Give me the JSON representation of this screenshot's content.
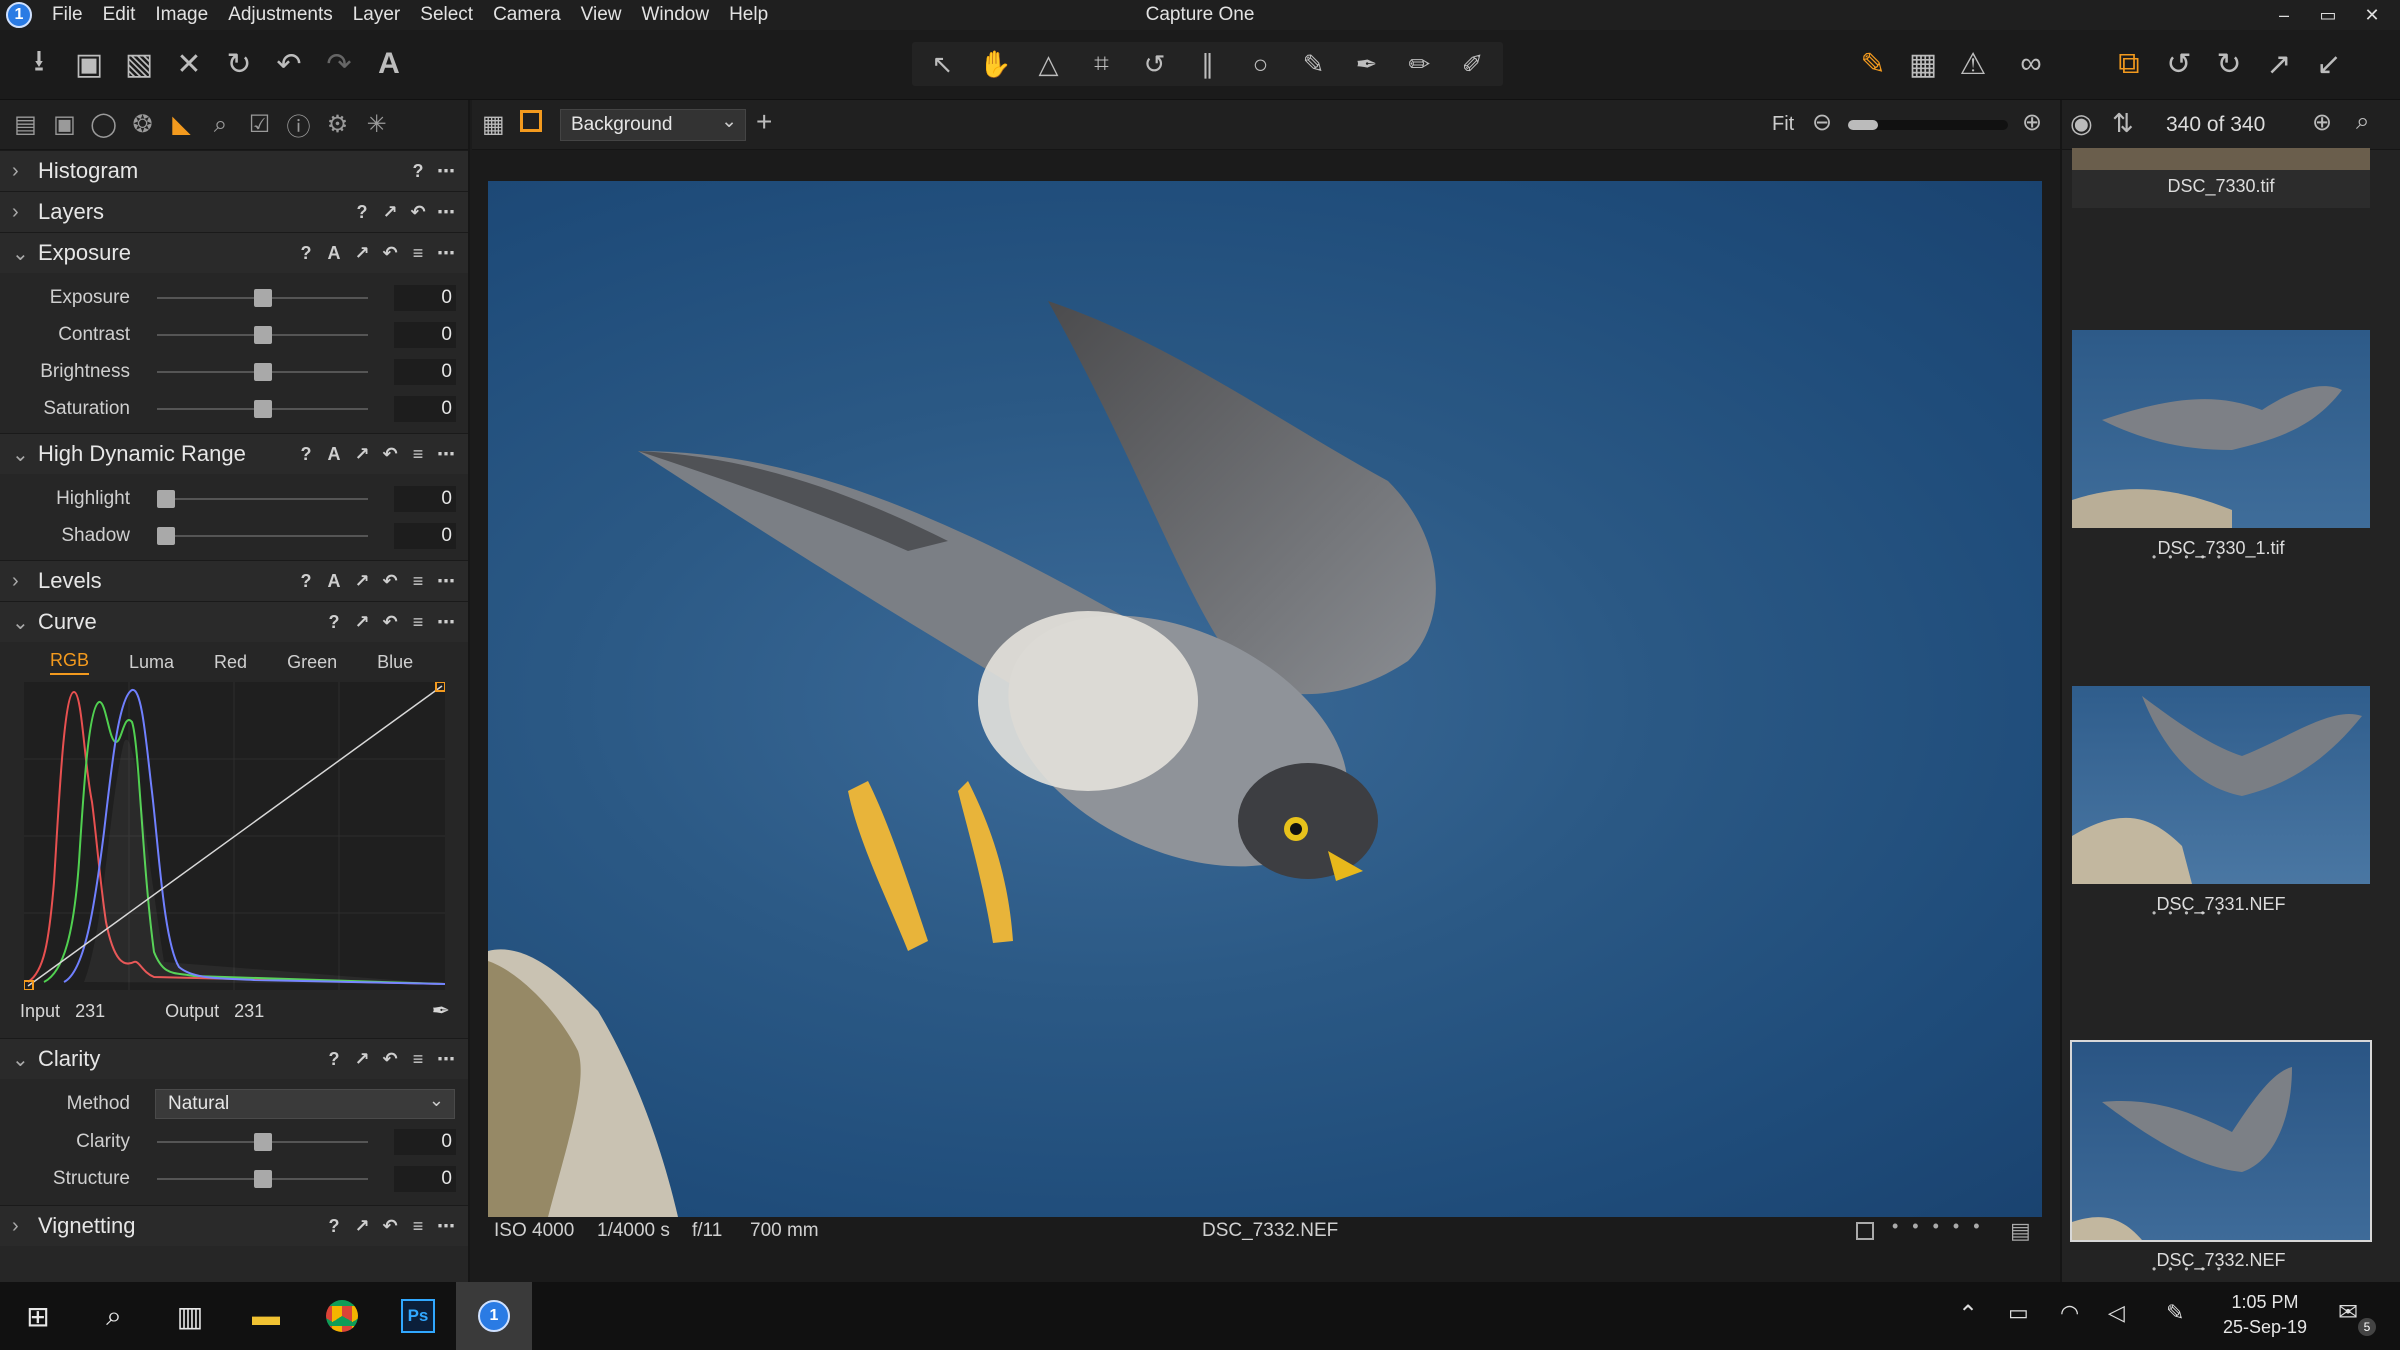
{
  "app": {
    "title": "Capture One",
    "logo_label": "1",
    "menu": [
      "File",
      "Edit",
      "Image",
      "Adjustments",
      "Layer",
      "Select",
      "Camera",
      "View",
      "Window",
      "Help"
    ],
    "window_controls": [
      "–",
      "▭",
      "✕"
    ]
  },
  "toolbar": {
    "left": [
      "import-icon",
      "camera-icon",
      "move-icon",
      "delete-icon",
      "undo-all-icon",
      "undo-icon",
      "redo-icon",
      "text-icon"
    ],
    "cursor_tools": [
      "select-icon",
      "pan-icon",
      "keystone-icon",
      "crop-icon",
      "rotate-icon",
      "straighten-icon",
      "spot-icon",
      "draw-mask-icon",
      "erase-mask-icon",
      "linear-mask-icon",
      "radial-mask-icon"
    ],
    "right": [
      "edit-icon",
      "grid-icon",
      "warning-icon",
      "proof-icon",
      "stack-icon",
      "rotate-left-icon",
      "rotate-right-icon",
      "export-icon",
      "import-arrow-icon"
    ]
  },
  "left_panel": {
    "tabs": [
      "library-icon",
      "capture-icon",
      "color-icon",
      "layers-icon",
      "exposure-tab-icon",
      "details-icon",
      "adjust-icon",
      "metadata-icon",
      "output-icon",
      "batch-icon"
    ],
    "sections": {
      "histogram": {
        "title": "Histogram"
      },
      "layers": {
        "title": "Layers"
      },
      "exposure": {
        "title": "Exposure",
        "sliders": [
          {
            "label": "Exposure",
            "value": "0",
            "position": 0.5
          },
          {
            "label": "Contrast",
            "value": "0",
            "position": 0.5
          },
          {
            "label": "Brightness",
            "value": "0",
            "position": 0.5
          },
          {
            "label": "Saturation",
            "value": "0",
            "position": 0.5
          }
        ]
      },
      "hdr": {
        "title": "High Dynamic Range",
        "sliders": [
          {
            "label": "Highlight",
            "value": "0",
            "position": 0.0
          },
          {
            "label": "Shadow",
            "value": "0",
            "position": 0.0
          }
        ]
      },
      "levels": {
        "title": "Levels"
      },
      "curve": {
        "title": "Curve",
        "tabs": [
          "RGB",
          "Luma",
          "Red",
          "Green",
          "Blue"
        ],
        "active_tab": "RGB",
        "input_label": "Input",
        "input_value": "231",
        "output_label": "Output",
        "output_value": "231"
      },
      "clarity": {
        "title": "Clarity",
        "method_label": "Method",
        "method_value": "Natural",
        "sliders": [
          {
            "label": "Clarity",
            "value": "0",
            "position": 0.5
          },
          {
            "label": "Structure",
            "value": "0",
            "position": 0.5
          }
        ]
      },
      "vignetting": {
        "title": "Vignetting"
      }
    }
  },
  "viewer": {
    "layer_select": "Background",
    "zoom_label": "Fit",
    "file_name": "DSC_7332.NEF",
    "meta": {
      "iso": "ISO 4000",
      "shutter": "1/4000 s",
      "aperture": "f/11",
      "focal": "700 mm"
    }
  },
  "browser": {
    "count": "340 of 340",
    "thumbnails": [
      {
        "name": "DSC_7330.tif"
      },
      {
        "name": "DSC_7330_1.tif"
      },
      {
        "name": "DSC_7331.NEF"
      },
      {
        "name": "DSC_7332.NEF",
        "selected": true
      }
    ]
  },
  "taskbar": {
    "time": "1:05 PM",
    "date": "25-Sep-19",
    "notifications": "5",
    "photoshop_label": "Ps",
    "c1_label": "1"
  },
  "colors": {
    "accent": "#f39a1e",
    "panel": "#262626",
    "background": "#1b1b1b"
  }
}
